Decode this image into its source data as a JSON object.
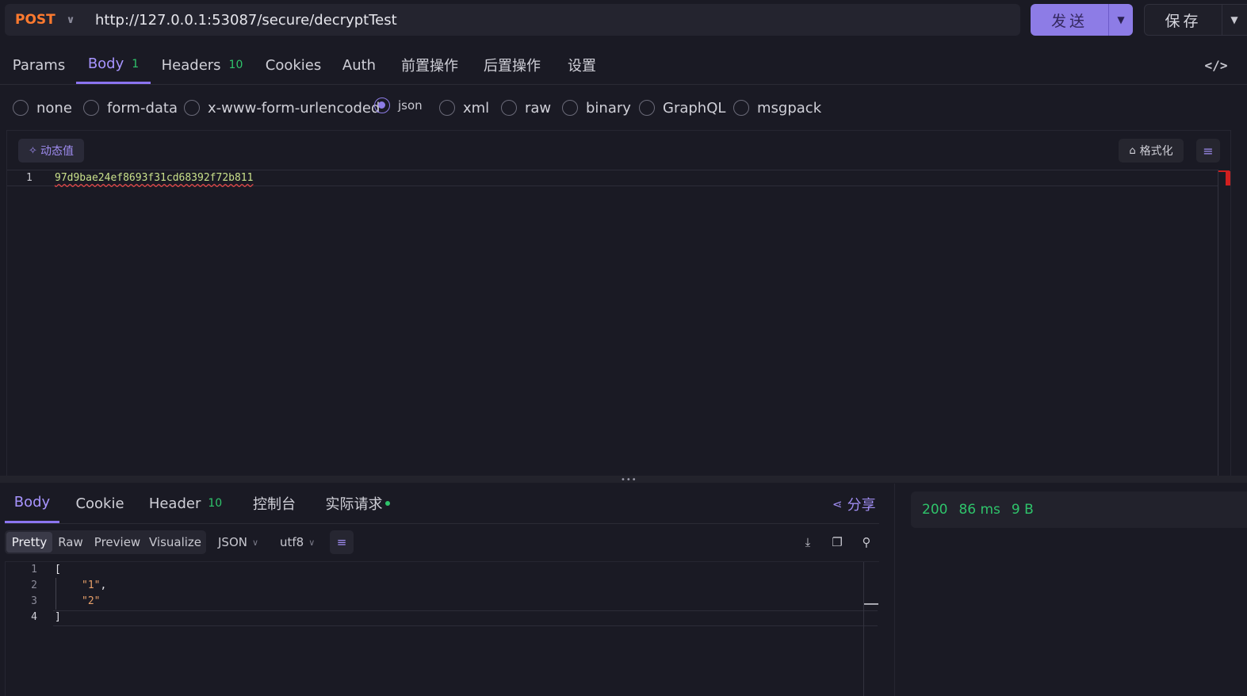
{
  "request": {
    "method": "POST",
    "url": "http://127.0.0.1:53087/secure/decryptTest",
    "send_label": "发送",
    "save_label": "保存"
  },
  "req_tabs": [
    {
      "label": "Params"
    },
    {
      "label": "Body",
      "count": "1"
    },
    {
      "label": "Headers",
      "count": "10"
    },
    {
      "label": "Cookies"
    },
    {
      "label": "Auth"
    },
    {
      "label": "前置操作"
    },
    {
      "label": "后置操作"
    },
    {
      "label": "设置"
    }
  ],
  "body_types": [
    {
      "label": "none",
      "selected": false
    },
    {
      "label": "form-data",
      "selected": false
    },
    {
      "label": "x-www-form-urlencoded",
      "selected": false
    },
    {
      "label": "json",
      "selected": true
    },
    {
      "label": "xml",
      "selected": false
    },
    {
      "label": "raw",
      "selected": false
    },
    {
      "label": "binary",
      "selected": false
    },
    {
      "label": "GraphQL",
      "selected": false
    },
    {
      "label": "msgpack",
      "selected": false
    }
  ],
  "editor": {
    "dynamic_label": "动态值",
    "format_label": "格式化",
    "lines": [
      {
        "num": "1",
        "text": "97d9bae24ef8693f31cd68392f72b811"
      }
    ]
  },
  "response": {
    "tabs": [
      {
        "label": "Body"
      },
      {
        "label": "Cookie"
      },
      {
        "label": "Header",
        "count": "10"
      },
      {
        "label": "控制台"
      },
      {
        "label": "实际请求"
      }
    ],
    "share_label": "分享",
    "views": [
      "Pretty",
      "Raw",
      "Preview",
      "Visualize"
    ],
    "format": "JSON",
    "encoding": "utf8",
    "lines": [
      {
        "num": "1",
        "text": "["
      },
      {
        "num": "2",
        "text": "\"1\"",
        "suffix": ","
      },
      {
        "num": "3",
        "text": "\"2\"",
        "suffix": ""
      },
      {
        "num": "4",
        "text": "]"
      }
    ],
    "status": {
      "code": "200",
      "time": "86 ms",
      "size": "9 B"
    }
  },
  "colors": {
    "accent": "#8d7ce6",
    "method": "#ff7a2f",
    "success": "#2fc46b",
    "background": "#1a1a24"
  }
}
